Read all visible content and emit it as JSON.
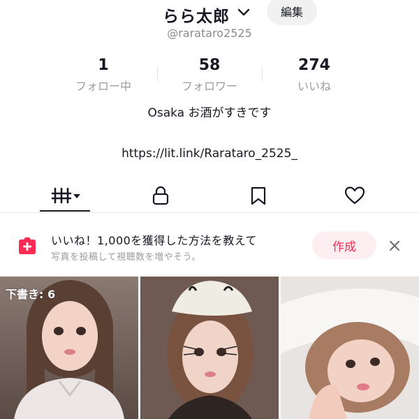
{
  "profile": {
    "display_name": "らら太郎",
    "handle": "@rarataro2525",
    "edit_label": "編集",
    "bio": "Osaka お酒がすきです",
    "link": "https://lit.link/Rarataro_2525_"
  },
  "stats": [
    {
      "value": "1",
      "label": "フォロー中"
    },
    {
      "value": "58",
      "label": "フォロワー"
    },
    {
      "value": "274",
      "label": "いいね"
    }
  ],
  "tabs": [
    {
      "icon": "grid-icon",
      "active": true
    },
    {
      "icon": "lock-icon",
      "active": false
    },
    {
      "icon": "bookmark-icon",
      "active": false
    },
    {
      "icon": "heart-icon",
      "active": false
    }
  ],
  "promo": {
    "title": "いいね！1,000を獲得した方法を教えて",
    "subtitle": "写真を投稿して視聴数を増やそう。",
    "button_label": "作成",
    "accent": "#fe2c55"
  },
  "grid": {
    "draft_label": "下書き: 6",
    "items": [
      {
        "kind": "draft"
      },
      {
        "kind": "post"
      },
      {
        "kind": "post"
      }
    ]
  }
}
